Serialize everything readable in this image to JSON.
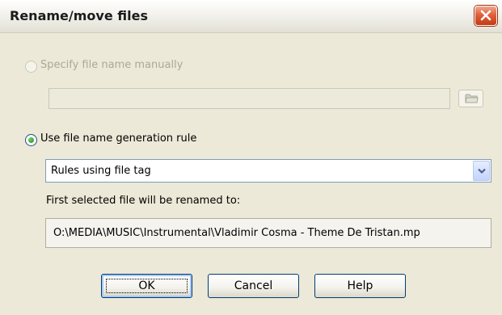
{
  "window": {
    "title": "Rename/move files"
  },
  "manual_option": {
    "label": "Specify file name manually",
    "selected": false,
    "enabled": false,
    "path_value": ""
  },
  "rule_option": {
    "label": "Use file name generation rule",
    "selected": true,
    "enabled": true
  },
  "rule_select": {
    "value": "Rules using file tag"
  },
  "preview": {
    "label": "First selected file will be renamed to:",
    "value": "O:\\MEDIA\\MUSIC\\Instrumental\\Vladimir Cosma - Theme De Tristan.mp"
  },
  "buttons": {
    "ok": "OK",
    "cancel": "Cancel",
    "help": "Help"
  },
  "icons": {
    "close": "close-icon",
    "browse": "folder-icon",
    "dropdown": "chevron-down-icon"
  }
}
